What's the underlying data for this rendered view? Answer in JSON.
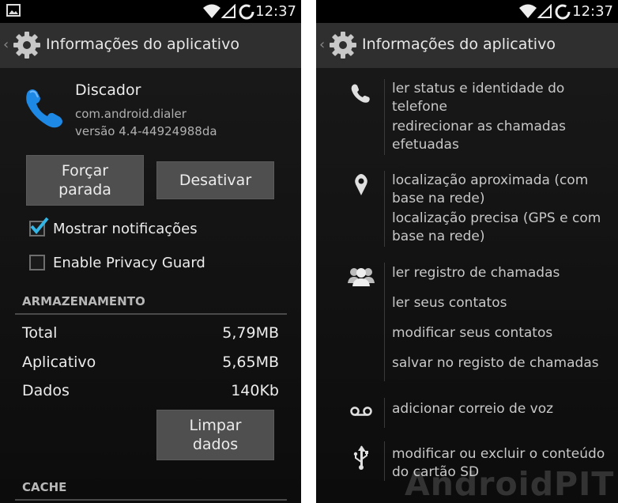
{
  "status_bar": {
    "time": "12:37"
  },
  "left_screen": {
    "action_bar_title": "Informações do aplicativo",
    "app": {
      "name": "Discador",
      "package": "com.android.dialer",
      "version": "versão 4.4-44924988da"
    },
    "buttons": {
      "force_stop": "Forçar parada",
      "disable": "Desativar",
      "clear_data": "Limpar dados"
    },
    "checkboxes": [
      {
        "label": "Mostrar notificações",
        "checked": true
      },
      {
        "label": "Enable Privacy Guard",
        "checked": false
      }
    ],
    "storage": {
      "heading": "ARMAZENAMENTO",
      "rows": [
        {
          "label": "Total",
          "value": "5,79MB"
        },
        {
          "label": "Aplicativo",
          "value": "5,65MB"
        },
        {
          "label": "Dados",
          "value": "140Kb"
        }
      ]
    },
    "cache_heading": "CACHE"
  },
  "right_screen": {
    "action_bar_title": "Informações do aplicativo",
    "permissions": [
      {
        "icon": "phone-icon",
        "items": [
          "ler status e identidade do telefone",
          "redirecionar as chamadas efetuadas"
        ]
      },
      {
        "icon": "location-pin-icon",
        "items": [
          "localização aproximada (com base na rede)",
          "localização precisa (GPS e com base na rede)"
        ]
      },
      {
        "icon": "people-icon",
        "items": [
          "ler registro de chamadas",
          "ler seus contatos",
          "modificar seus contatos",
          "salvar no registo de chamadas"
        ]
      },
      {
        "icon": "voicemail-icon",
        "items": [
          "adicionar correio de voz"
        ]
      },
      {
        "icon": "usb-icon",
        "items": [
          "modificar ou excluir o conteúdo do cartão SD"
        ]
      }
    ]
  },
  "watermark": "AndroidPIT",
  "colors": {
    "accent_check": "#33b5e5",
    "app_icon_blue": "#1e88e5"
  }
}
